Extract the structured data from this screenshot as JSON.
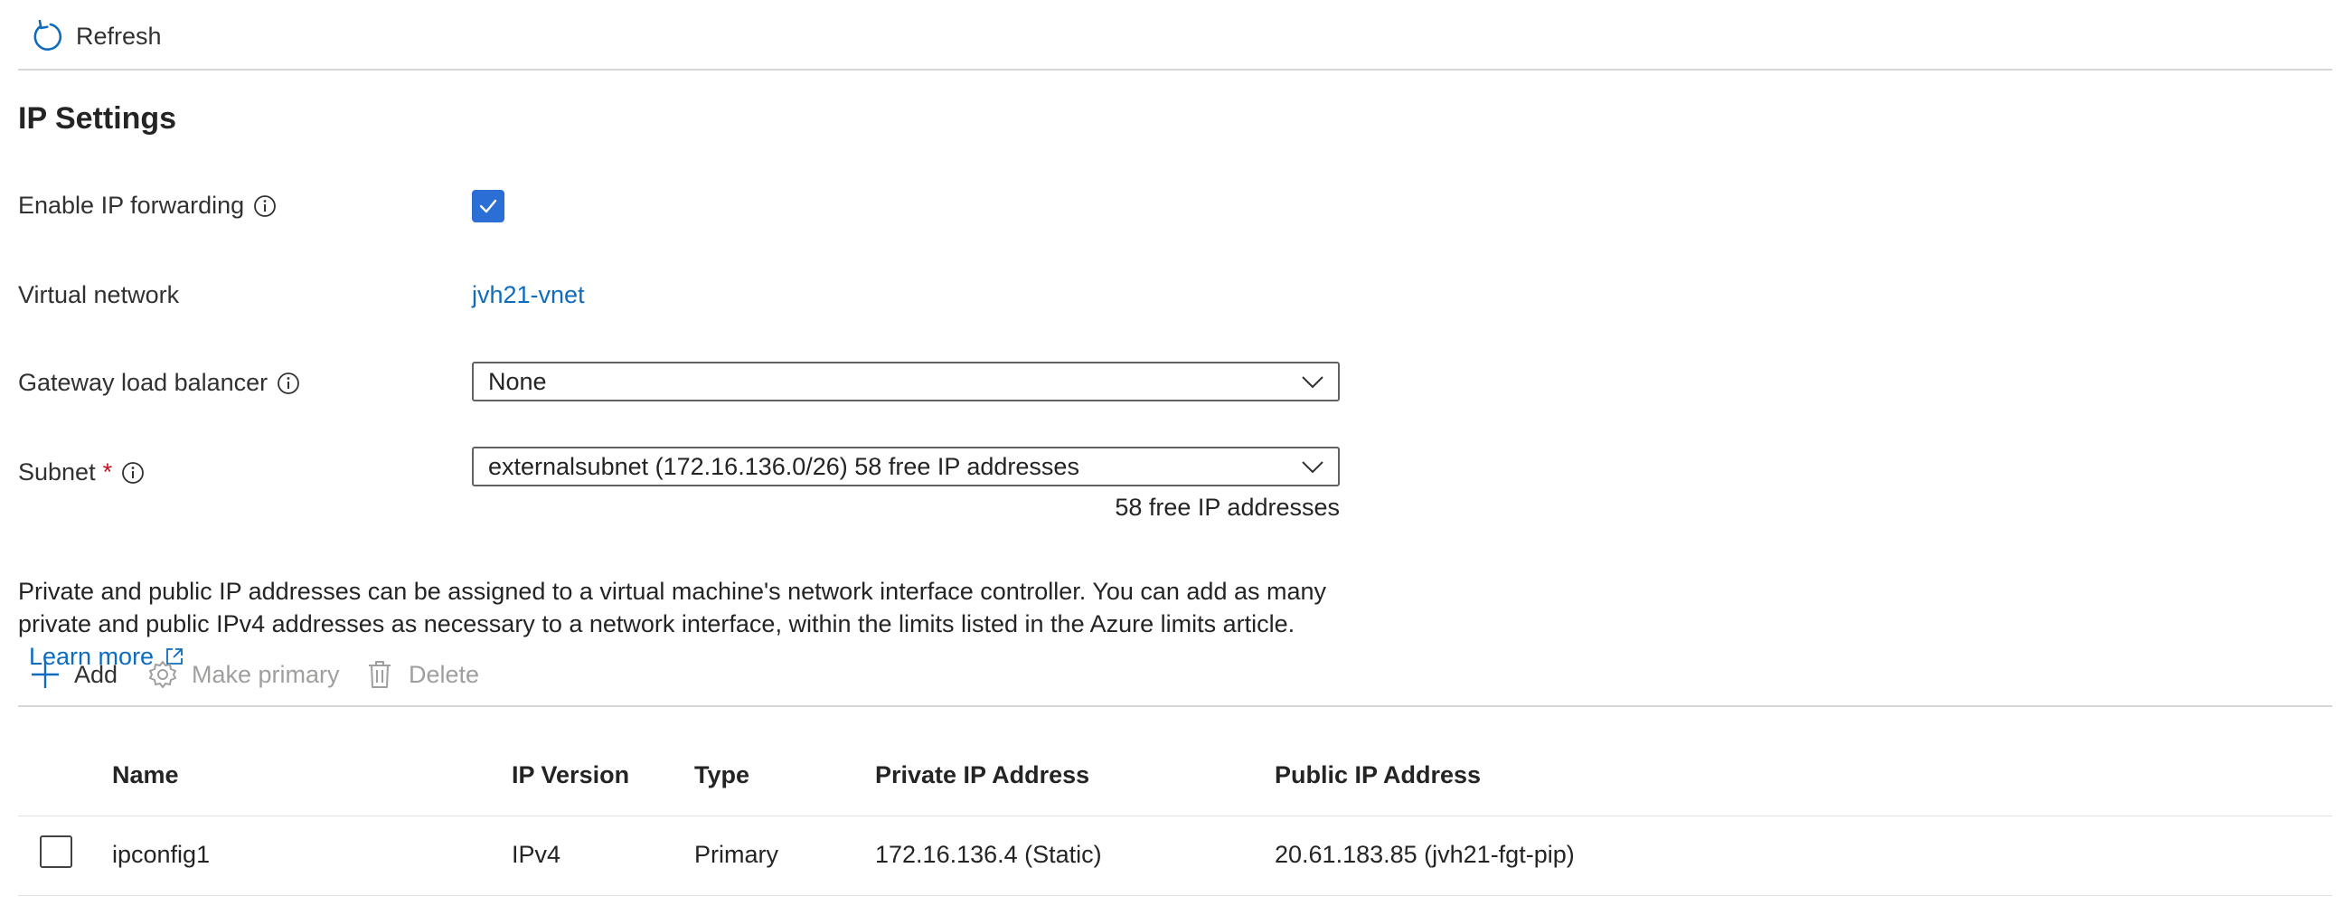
{
  "commandbar": {
    "refresh_label": "Refresh"
  },
  "section": {
    "title": "IP Settings"
  },
  "fields": {
    "ip_forwarding": {
      "label": "Enable IP forwarding",
      "checked": true
    },
    "virtual_network": {
      "label": "Virtual network",
      "value": "jvh21-vnet"
    },
    "gateway_lb": {
      "label": "Gateway load balancer",
      "value": "None"
    },
    "subnet": {
      "label": "Subnet",
      "required_mark": "*",
      "value": "externalsubnet (172.16.136.0/26) 58 free IP addresses",
      "helper": "58 free IP addresses"
    }
  },
  "description": {
    "text": "Private and public IP addresses can be assigned to a virtual machine's network interface controller. You can add as many private and public IPv4 addresses as necessary to a network interface, within the limits listed in the Azure limits article.",
    "link_label": "Learn more"
  },
  "toolbar": {
    "add_label": "Add",
    "make_primary_label": "Make primary",
    "delete_label": "Delete"
  },
  "table": {
    "headers": [
      "Name",
      "IP Version",
      "Type",
      "Private IP Address",
      "Public IP Address"
    ],
    "rows": [
      [
        "ipconfig1",
        "IPv4",
        "Primary",
        "172.16.136.4 (Static)",
        "20.61.183.85 (jvh21-fgt-pip)"
      ]
    ]
  },
  "colors": {
    "accent": "#0f6cbd",
    "checkbox": "#2b6fd6",
    "disabled": "#a19f9d"
  }
}
